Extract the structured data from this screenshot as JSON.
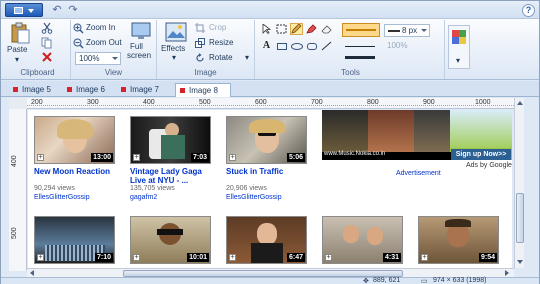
{
  "quick_access": {
    "undo_icon": "↶",
    "redo_icon": "↷",
    "help_label": "?"
  },
  "ribbon": {
    "clipboard": {
      "paste_label": "Paste",
      "group_label": "Clipboard"
    },
    "view": {
      "zoom_in_label": "Zoom In",
      "zoom_out_label": "Zoom Out",
      "zoom_value": "100%",
      "full_screen_line1": "Full",
      "full_screen_line2": "screen",
      "group_label": "View"
    },
    "image": {
      "effects_label": "Effects",
      "crop_label": "Crop",
      "resize_label": "Resize",
      "rotate_label": "Rotate",
      "group_label": "Image"
    },
    "tools": {
      "group_label": "Tools",
      "size_value": "8 px",
      "opacity_value": "100%"
    }
  },
  "tabs": [
    {
      "label": "Image 5",
      "active": false
    },
    {
      "label": "Image 6",
      "active": false
    },
    {
      "label": "Image 7",
      "active": false
    },
    {
      "label": "Image 8",
      "active": true
    }
  ],
  "ruler": {
    "h_numbers": [
      "200",
      "300",
      "400",
      "500",
      "600",
      "700",
      "800",
      "900",
      "1000"
    ],
    "v_numbers": [
      "400",
      "500"
    ]
  },
  "videos_row1": [
    {
      "title_line1": "New Moon Reaction",
      "title_line2": "",
      "views": "90,294 views",
      "user": "EllesGlitterGossip",
      "duration": "13:00"
    },
    {
      "title_line1": "Vintage Lady Gaga",
      "title_line2": "Live at NYU - ...",
      "views": "135,705 views",
      "user": "gagafm2",
      "duration": "7:03"
    },
    {
      "title_line1": "Stuck in Traffic",
      "title_line2": "",
      "views": "20,906 views",
      "user": "EllesGlitterGossip",
      "duration": "5:06"
    }
  ],
  "videos_row2": [
    {
      "duration": "7:10"
    },
    {
      "duration": "10:01"
    },
    {
      "duration": "6:47"
    },
    {
      "duration": "4:31"
    },
    {
      "duration": "9:54"
    }
  ],
  "advertisement": {
    "signup_label": "Sign up Now>>",
    "url_text": "www.Music.Nokia.co.in",
    "ads_by": "Ads by Google",
    "caption": "Advertisement"
  },
  "status": {
    "cursor_pos": "889, 621",
    "image_size": "974 × 633 (1998)"
  },
  "colors": {
    "accent": "#2c5f92",
    "tab_dot": "#d8222b",
    "link": "#0033cc"
  }
}
